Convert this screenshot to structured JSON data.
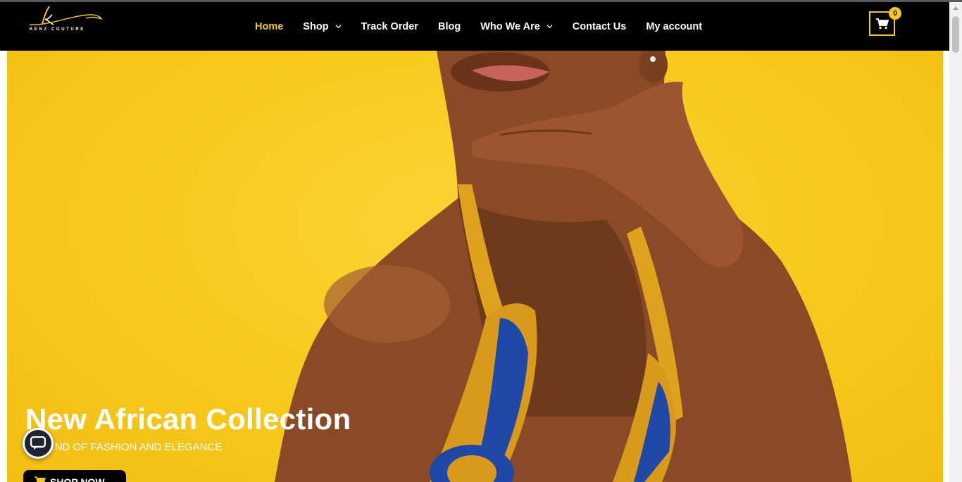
{
  "brand": {
    "name": "KENZ COUTURE",
    "logo_letter": "k",
    "accent_color": "#f6c622"
  },
  "nav": {
    "items": [
      {
        "label": "Home",
        "active": true,
        "dropdown": false
      },
      {
        "label": "Shop",
        "active": false,
        "dropdown": true
      },
      {
        "label": "Track Order",
        "active": false,
        "dropdown": false
      },
      {
        "label": "Blog",
        "active": false,
        "dropdown": false
      },
      {
        "label": "Who We Are",
        "active": false,
        "dropdown": true
      },
      {
        "label": "Contact Us",
        "active": false,
        "dropdown": false
      },
      {
        "label": "My account",
        "active": false,
        "dropdown": false
      }
    ]
  },
  "cart": {
    "count": "0",
    "icon": "cart-icon"
  },
  "hero": {
    "title": "New African Collection",
    "subtitle": "A BLEND OF FASHION AND ELEGANCE",
    "button_label": "SHOP NOW",
    "background_color": "#f7c91c"
  },
  "chat": {
    "icon": "chat-icon"
  }
}
